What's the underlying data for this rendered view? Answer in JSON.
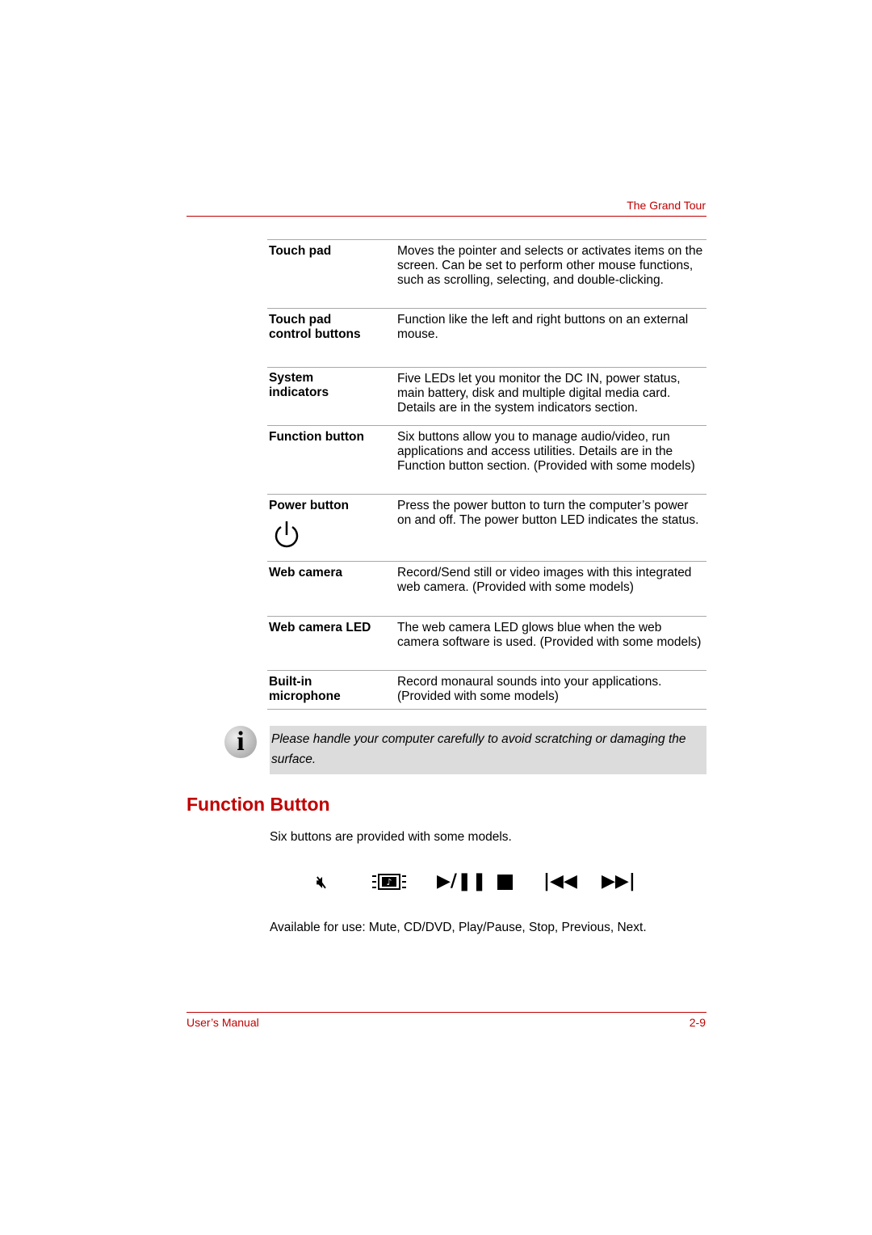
{
  "header": {
    "section": "The Grand Tour"
  },
  "table": [
    {
      "term": "Touch pad",
      "desc": "Moves the pointer and selects or activates items on the screen. Can be set to perform other mouse functions, such as scrolling, selecting, and double-clicking."
    },
    {
      "term": "Touch pad control buttons",
      "desc": "Function like the left and right buttons on an external mouse."
    },
    {
      "term": "System indicators",
      "desc": "Five LEDs let you monitor the DC IN, power status, main battery, disk and multiple digital media card. Details are in the system indicators section."
    },
    {
      "term": "Function button",
      "desc": "Six buttons allow you to manage audio/video, run applications and access utilities. Details are in the Function button section. (Provided with some models)"
    },
    {
      "term": "Power button",
      "desc": "Press the power button to turn the computer’s power on and off. The power button LED indicates the status."
    },
    {
      "term": "Web camera",
      "desc": "Record/Send still or video images with this integrated web camera. (Provided with some models)"
    },
    {
      "term": "Web camera LED",
      "desc": "The web camera LED glows blue when the web camera software is used. (Provided with some models)"
    },
    {
      "term": "Built-in microphone",
      "desc": "Record monaural sounds into your applications. (Provided with some models)"
    }
  ],
  "note": "Please handle your computer carefully to avoid scratching or damaging the surface.",
  "section": {
    "title": "Function Button",
    "intro": "Six buttons are provided with some models.",
    "available": "Available for use: Mute, CD/DVD, Play/Pause, Stop, Previous, Next."
  },
  "icons": [
    "mute-icon",
    "cd-dvd-icon",
    "play-pause-icon",
    "stop-icon",
    "previous-icon",
    "next-icon"
  ],
  "footer": {
    "left": "User’s Manual",
    "right": "2-9"
  },
  "colors": {
    "accent": "#c00000",
    "note_bg": "#dcdcdc"
  }
}
